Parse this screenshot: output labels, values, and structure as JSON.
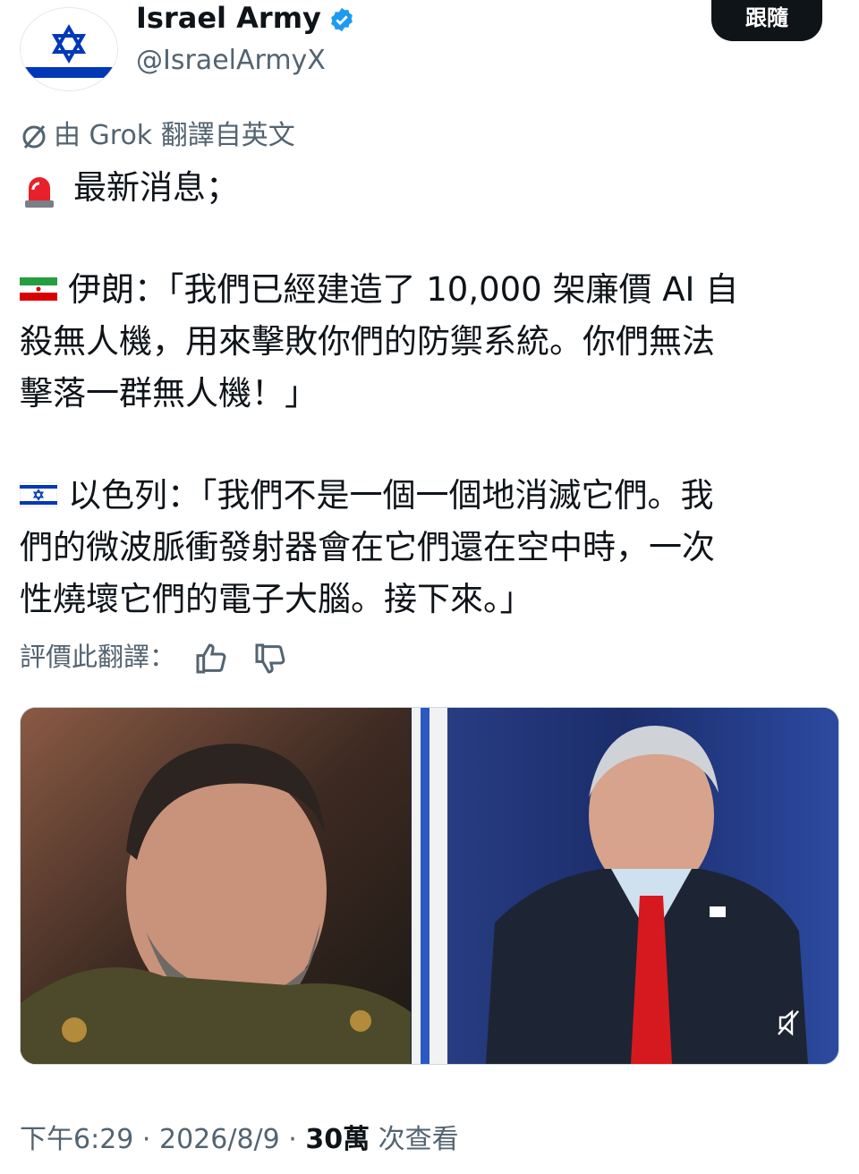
{
  "header": {
    "display_name": "Israel Army",
    "handle": "@IsraelArmyX",
    "follow_label": "跟隨"
  },
  "translation": {
    "label": "由 Grok 翻譯自英文",
    "rate_label": "評價此翻譯："
  },
  "post": {
    "line1": "最新消息；",
    "iran": [
      "伊朗：「我們已經建造了 10,000 架廉價 AI 自",
      "殺無人機，用來擊敗你們的防禦系統。你們無法",
      "擊落一群無人機！」"
    ],
    "israel": [
      "以色列：「我們不是一個一個地消滅它們。我",
      "們的微波脈衝發射器會在它們還在空中時，一次",
      "性燒壞它們的電子大腦。接下來。」"
    ]
  },
  "footer": {
    "time": "下午6:29",
    "date": "2026/8/9",
    "views": "30萬",
    "views_label": "次查看"
  },
  "icons": [
    "verified-badge-icon",
    "grok-icon",
    "siren-icon",
    "iran-flag-icon",
    "israel-flag-icon",
    "thumbs-up-icon",
    "thumbs-down-icon",
    "mute-icon"
  ],
  "colors": {
    "accent": "#1d9bf0",
    "text": "#0f1419",
    "muted": "#536471",
    "flag_blue": "#0038b8"
  }
}
